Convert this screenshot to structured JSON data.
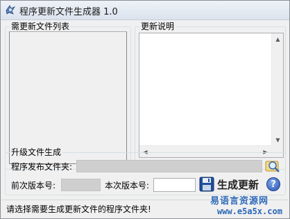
{
  "window": {
    "title": "程序更新文件生成器 1.0"
  },
  "files_group": {
    "legend": "需更新文件列表"
  },
  "notes_group": {
    "legend": "更新说明"
  },
  "generate_group": {
    "legend": "升级文件生成",
    "publish_folder_label": "程序发布文件夹:",
    "publish_folder_value": "",
    "prev_version_label": "前次版本号:",
    "prev_version_value": "",
    "this_version_label": "本次版本号:",
    "this_version_value": "",
    "generate_button_label": "生成更新",
    "help_label": "?"
  },
  "status": {
    "text": "请选择需要生成更新文件的程序文件夹!"
  },
  "watermark": {
    "site_name": "易语言资源网",
    "url": "www.e5a5x.com"
  },
  "colors": {
    "accent": "#2c68b6",
    "floppy": "#1f4e9a"
  }
}
